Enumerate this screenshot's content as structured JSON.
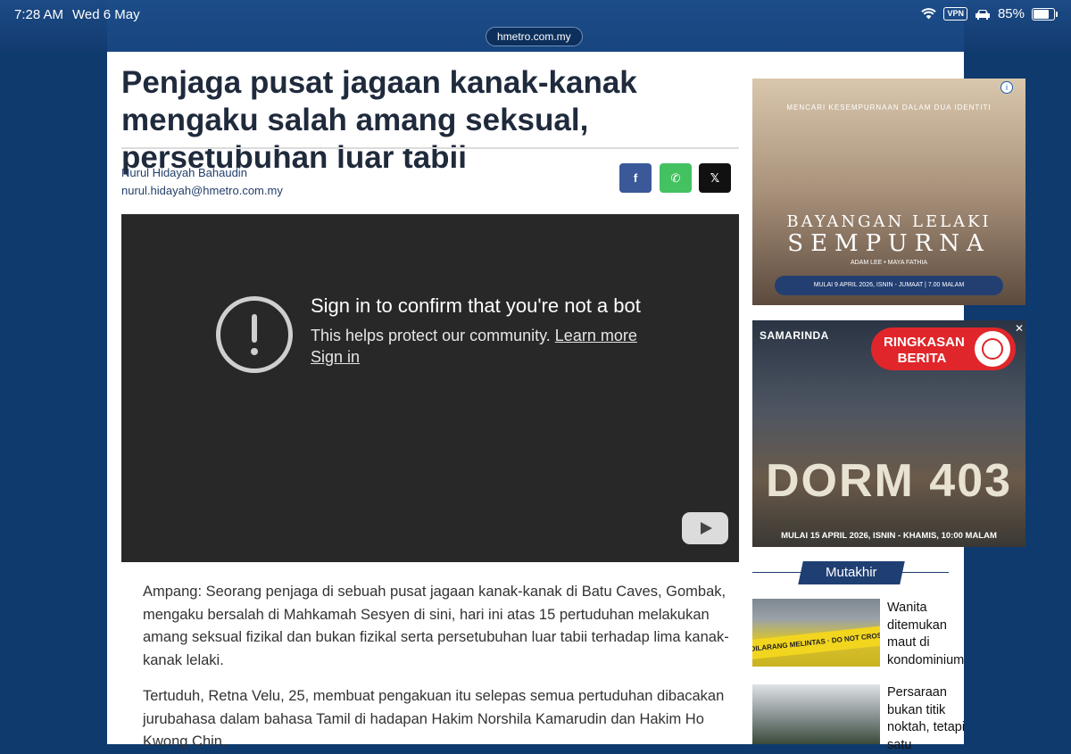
{
  "status_bar": {
    "time": "7:28 AM",
    "date": "Wed 6 May",
    "vpn": "VPN",
    "battery": "85%"
  },
  "browser": {
    "url": "hmetro.com.my"
  },
  "article": {
    "headline": "Penjaga pusat jagaan kanak-kanak mengaku salah amang seksual, persetubuhan luar tabii",
    "author_name": "Nurul Hidayah Bahaudin",
    "author_email": "nurul.hidayah@hmetro.com.my",
    "share": {
      "facebook": "f",
      "whatsapp": "✆",
      "x": "𝕏"
    },
    "video": {
      "title": "Sign in to confirm that you're not a bot",
      "subtitle": "This helps protect our community.",
      "learn_more": "Learn more",
      "sign_in": "Sign in"
    },
    "paragraphs": [
      "Ampang: Seorang penjaga di sebuah pusat jagaan kanak-kanak di Batu Caves, Gombak, mengaku bersalah di Mahkamah Sesyen di sini, hari ini atas 15 pertuduhan melakukan amang seksual fizikal dan bukan fizikal serta persetubuhan luar tabii terhadap lima kanak-kanak lelaki.",
      "Tertuduh, Retna Velu, 25, membuat pengakuan itu selepas semua pertuduhan dibacakan jurubahasa dalam bahasa Tamil di hadapan Hakim Norshila Kamarudin dan Hakim Ho Kwong Chin."
    ]
  },
  "ads": {
    "ad1": {
      "tagline": "MENCARI KESEMPURNAAN DALAM DUA IDENTITI",
      "title_line1": "BAYANGAN LELAKI",
      "title_line2": "SEMPURNA",
      "cast": "ADAM LEE  •  MAYA FATHIA",
      "schedule": "MULAI 9 APRIL 2026, ISNIN - JUMAAT | 7.00 MALAM",
      "info": "i"
    },
    "ad2": {
      "brand": "SAMARINDA",
      "badge_line1": "RINGKASAN",
      "badge_line2": "BERITA",
      "title": "DORM 403",
      "schedule": "MULAI 15 APRIL 2026, ISNIN - KHAMIS, 10:00 MALAM",
      "close": "✕"
    }
  },
  "sidebar": {
    "section_title": "Mutakhir",
    "news": [
      {
        "title": "Wanita ditemukan maut di kondominium",
        "thumb_text": "DILARANG MELINTAS · DO NOT CROSS"
      },
      {
        "title": "Persaraan bukan titik noktah, tetapi satu"
      }
    ]
  }
}
